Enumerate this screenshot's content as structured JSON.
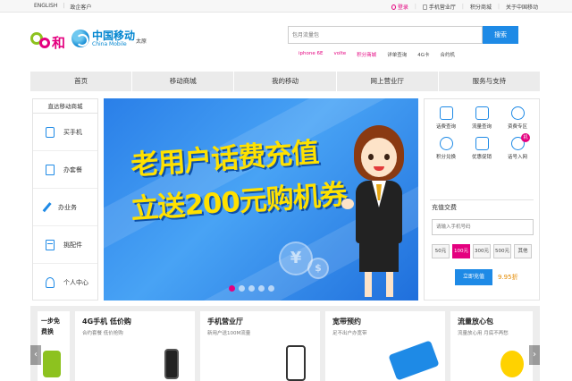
{
  "topbar": {
    "english": "ENGLISH",
    "gov": "政企客户",
    "login": "登录",
    "mobile_hall": "手机营业厅",
    "points_mall": "积分商城",
    "about": "关于中国移动"
  },
  "header": {
    "brand_he": "和",
    "brand_cn": "中国移动",
    "brand_en": "China Mobile",
    "city": "太原"
  },
  "search": {
    "placeholder": "包月流量包",
    "button": "搜索",
    "hotwords": [
      "iphone 6E",
      "volte",
      "积分商城",
      "详单查询",
      "4G卡",
      "合约机"
    ]
  },
  "nav": [
    "首页",
    "移动商城",
    "我的移动",
    "网上营业厅",
    "服务与支持"
  ],
  "sidebar": {
    "title": "直达移动商城",
    "items": [
      {
        "label": "买手机",
        "icon": "phone-icon"
      },
      {
        "label": "办套餐",
        "icon": "document-icon"
      },
      {
        "label": "办业务",
        "icon": "wrench-icon"
      },
      {
        "label": "挑配件",
        "icon": "box-icon"
      },
      {
        "label": "个人中心",
        "icon": "user-icon"
      }
    ]
  },
  "banner": {
    "line1": "老用户话费充值",
    "line2": "立送200元购机券",
    "slides": 5,
    "active_slide": 1
  },
  "quick": [
    {
      "label": "话费查询",
      "icon": "phone-bill-icon"
    },
    {
      "label": "流量查询",
      "icon": "chart-icon"
    },
    {
      "label": "资费专区",
      "icon": "tag-icon"
    },
    {
      "label": "积分兑换",
      "icon": "exchange-icon"
    },
    {
      "label": "优惠促销",
      "icon": "gift-icon"
    },
    {
      "label": "话号入网",
      "icon": "sim-icon",
      "badge": "机"
    }
  ],
  "recharge": {
    "title": "充值交费",
    "placeholder": "请输入手机号码",
    "amounts": [
      "50元",
      "100元",
      "300元",
      "500元",
      "其他"
    ],
    "selected": "100元",
    "button": "立即充值",
    "price": "9.95折"
  },
  "bottom": [
    {
      "title": "一步免",
      "sub": "费换"
    },
    {
      "title": "4G手机 低价购",
      "sub": "合约套餐 低价抢购"
    },
    {
      "title": "手机营业厅",
      "sub": "新用户送100M流量"
    },
    {
      "title": "宽带预约",
      "sub": "足不出户办宽带"
    },
    {
      "title": "流量放心包",
      "sub": "流量放心用 月底不再愁"
    }
  ],
  "colors": {
    "brand_blue": "#1e8ae6",
    "brand_pink": "#e4007f",
    "banner_text": "#ffe100"
  }
}
